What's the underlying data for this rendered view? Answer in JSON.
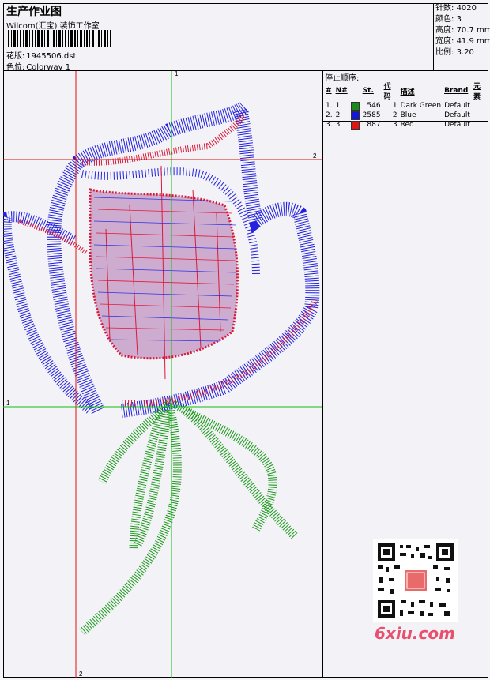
{
  "header": {
    "title": "生产作业图",
    "subtitle": "Wilcom(汇宝) 装饰工作室",
    "design_label": "花版:",
    "design_value": "1945506.dst",
    "colorway_label": "色位:",
    "colorway_value": "Colorway 1"
  },
  "stats": [
    {
      "label": "针数:",
      "value": "4020"
    },
    {
      "label": "颜色:",
      "value": "3"
    },
    {
      "label": "高度:",
      "value": "70.7 mm"
    },
    {
      "label": "宽度:",
      "value": "41.9 mm"
    },
    {
      "label": "比例:",
      "value": "3.20"
    }
  ],
  "guides": {
    "v1": "1",
    "v2": "2",
    "h1": "1",
    "h2": "2"
  },
  "sequence": {
    "title": "停止顺序:",
    "headers": [
      "#",
      "N#",
      "St.",
      "代码",
      "描述",
      "Brand",
      "元素"
    ],
    "rows": [
      {
        "num": "1.",
        "n": "1",
        "color": "#1a8a1a",
        "st": "546",
        "code": "1",
        "desc": "Dark Green",
        "brand": "Default"
      },
      {
        "num": "2.",
        "n": "2",
        "color": "#1616d8",
        "st": "2585",
        "code": "2",
        "desc": "Blue",
        "brand": "Default"
      },
      {
        "num": "3.",
        "n": "3",
        "color": "#e01414",
        "st": "887",
        "code": "3",
        "desc": "Red",
        "brand": "Default"
      }
    ]
  },
  "watermark": {
    "logo_text": "6xiu.com"
  }
}
